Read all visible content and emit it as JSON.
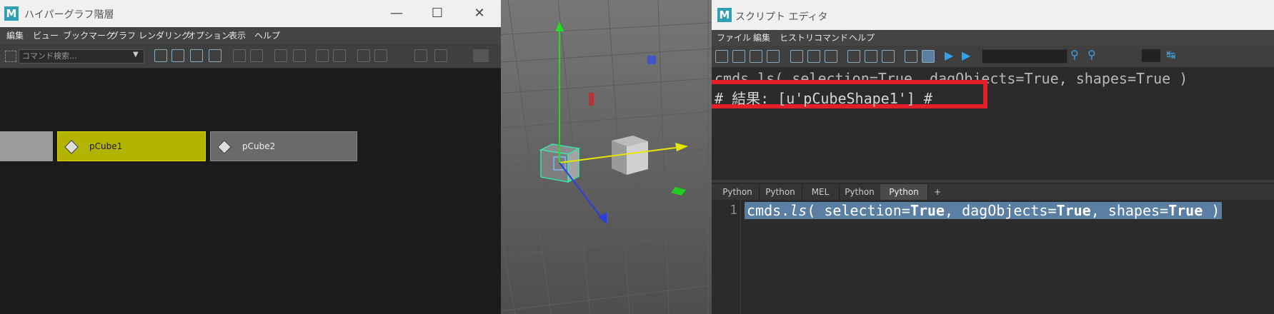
{
  "hypergraph": {
    "title": "ハイパーグラフ階層",
    "menu": [
      "編集",
      "ビュー",
      "ブックマーク",
      "グラフ",
      "レンダリング",
      "オプション",
      "表示",
      "ヘルプ"
    ],
    "search_placeholder": "コマンド検索...",
    "nodes": [
      {
        "label": ""
      },
      {
        "label": "pCube1"
      },
      {
        "label": "pCube2"
      }
    ]
  },
  "script_editor": {
    "title": "スクリプト エディタ",
    "menu": [
      "ファイル",
      "編集",
      "ヒストリ",
      "コマンド",
      "ヘルプ"
    ],
    "history_command": "cmds.ls( selection=True, dagObjects=True, shapes=True )",
    "result_line": "# 結果: [u'pCubeShape1'] #",
    "tabs": [
      "Python",
      "Python",
      "MEL",
      "Python",
      "Python",
      "+"
    ],
    "active_tab_index": 4,
    "line_number": "1",
    "input_parts": {
      "fn_prefix": "cmds.",
      "fn_name": "ls",
      "arg1": "( selection=",
      "kw1": "True",
      "arg2": ", dagObjects=",
      "kw2": "True",
      "arg3": ", shapes=",
      "kw3": "True",
      "end": " )"
    }
  },
  "colors": {
    "highlight_box": "#e3202a",
    "selected_node": "#b3b400",
    "selection_bg": "#5a7fa3"
  }
}
